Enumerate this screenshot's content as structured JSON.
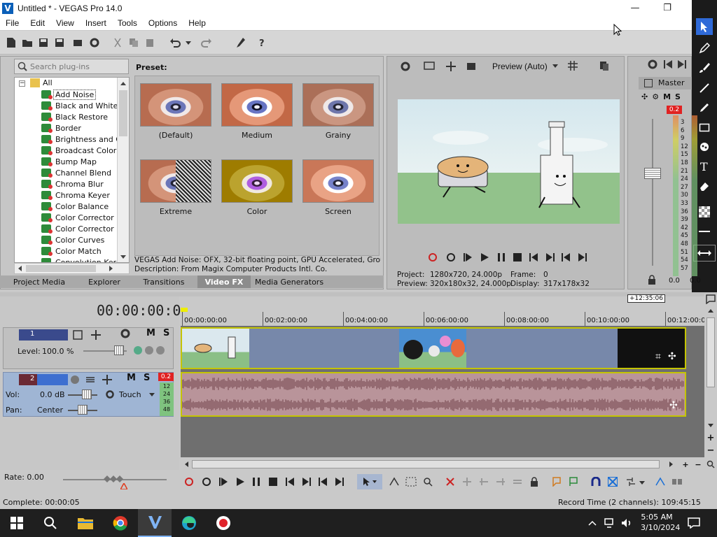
{
  "window": {
    "title": "Untitled * - VEGAS Pro 14.0",
    "minimize": "—",
    "maximize": "❐"
  },
  "menu": [
    "File",
    "Edit",
    "View",
    "Insert",
    "Tools",
    "Options",
    "Help"
  ],
  "plugins": {
    "search_placeholder": "Search plug-ins",
    "root": "All",
    "items": [
      "Add Noise",
      "Black and White",
      "Black Restore",
      "Border",
      "Brightness and Co",
      "Broadcast Colors",
      "Bump Map",
      "Channel Blend",
      "Chroma Blur",
      "Chroma Keyer",
      "Color Balance",
      "Color Corrector",
      "Color Corrector (S",
      "Color Curves",
      "Color Match",
      "Convolution Kerne"
    ],
    "selected": "Add Noise",
    "preset_label": "Preset:",
    "presets": [
      "(Default)",
      "Medium",
      "Grainy",
      "Extreme",
      "Color",
      "Screen"
    ],
    "description_1": "VEGAS Add Noise: OFX, 32-bit floating point, GPU Accelerated, Grouping",
    "description_2": "Description: From Magix Computer Products Intl. Co."
  },
  "tabs": [
    "Project Media",
    "Explorer",
    "Transitions",
    "Video FX",
    "Media Generators"
  ],
  "active_tab": "Video FX",
  "preview": {
    "mode": "Preview (Auto)",
    "project_label": "Project:",
    "project_value": "1280x720, 24.000p",
    "preview_label": "Preview:",
    "preview_value": "320x180x32, 24.000p",
    "frame_label": "Frame:",
    "frame_value": "0",
    "display_label": "Display:",
    "display_value": "317x178x32"
  },
  "master": {
    "label": "Master",
    "peak": "0.2",
    "scale": [
      "3",
      "6",
      "9",
      "12",
      "15",
      "18",
      "21",
      "24",
      "27",
      "30",
      "33",
      "36",
      "39",
      "42",
      "45",
      "48",
      "51",
      "54",
      "57"
    ],
    "left_value": "0.0",
    "right_value": "0.0"
  },
  "timeline": {
    "timecode": "00:00:00:00",
    "marker": "+12:35:06",
    "ruler": [
      "00:00:00:00",
      "00:02:00:00",
      "00:04:00:00",
      "00:06:00:00",
      "00:08:00:00",
      "00:10:00:00",
      "00:12:00:00"
    ],
    "track1": {
      "number": "1",
      "level_label": "Level:",
      "level_value": "100.0 %"
    },
    "track2": {
      "number": "2",
      "vol_label": "Vol:",
      "vol_value": "0.0 dB",
      "pan_label": "Pan:",
      "pan_value": "Center",
      "mode": "Touch",
      "peak": "0.2",
      "meter": [
        "12",
        "24",
        "36",
        "48"
      ]
    },
    "rate_label": "Rate: 0.00"
  },
  "status": {
    "left": "Complete: 00:00:05",
    "right": "Record Time (2 channels): 109:45:15"
  },
  "taskbar": {
    "time": "5:05 AM",
    "date": "3/10/2024"
  },
  "colors": {
    "accent_blue": "#1a6fd6",
    "record_red": "#cc2222",
    "clip_outline": "#c4c400"
  }
}
